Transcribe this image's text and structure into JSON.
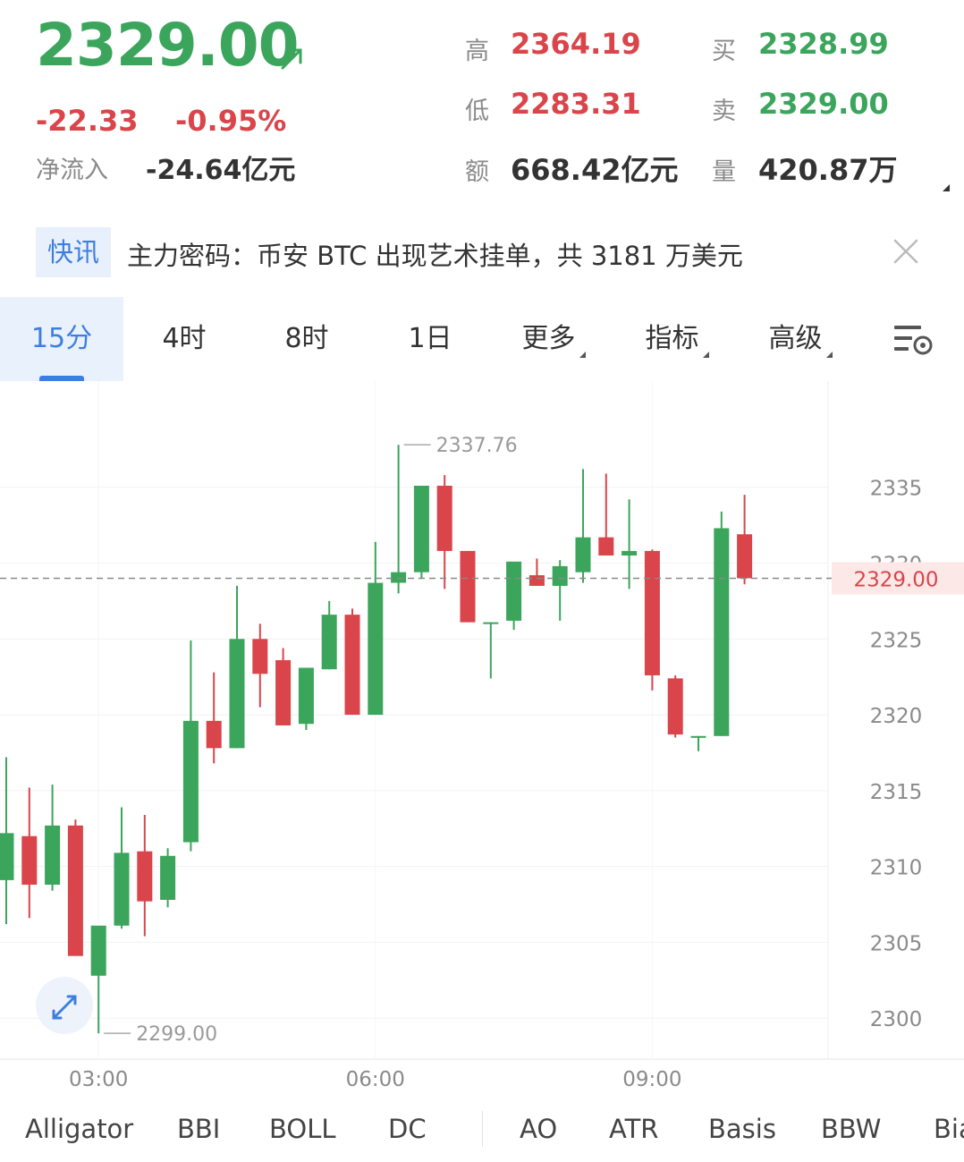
{
  "quote": {
    "price": "2329.00",
    "change": "-22.33",
    "change_pct": "-0.95%",
    "netflow_label": "净流入",
    "netflow_value": "-24.64亿元",
    "high_label": "高",
    "high": "2364.19",
    "low_label": "低",
    "low": "2283.31",
    "amount_label": "额",
    "amount": "668.42亿元",
    "bid_label": "买",
    "bid": "2328.99",
    "ask_label": "卖",
    "ask": "2329.00",
    "volume_label": "量",
    "volume": "420.87万"
  },
  "news": {
    "tag": "快讯",
    "text": "主力密码：币安 BTC 出现艺术挂单，共 3181 万美元"
  },
  "tabs": [
    "15分",
    "4时",
    "8时",
    "1日",
    "更多",
    "指标",
    "高级"
  ],
  "indicators": [
    "Alligator",
    "BBI",
    "BOLL",
    "DC",
    "AO",
    "ATR",
    "Basis",
    "BBW",
    "Bia"
  ],
  "colors": {
    "up": "#3ba55c",
    "down": "#d9454a",
    "accent": "#3d7fe0"
  },
  "chart_data": {
    "type": "candlestick",
    "x_ticks": [
      "03:00",
      "06:00",
      "09:00"
    ],
    "y_ticks": [
      2300,
      2305,
      2310,
      2315,
      2320,
      2325,
      2330,
      2335
    ],
    "ylim": [
      2297.3,
      2342.0
    ],
    "current_price": 2329.0,
    "current_price_label": "2329.00",
    "max_label": "2337.76",
    "min_label": "2299.00",
    "candles": [
      {
        "o": 2309.1,
        "h": 2317.2,
        "l": 2306.2,
        "c": 2312.2
      },
      {
        "o": 2312.0,
        "h": 2315.2,
        "l": 2306.6,
        "c": 2308.8
      },
      {
        "o": 2308.8,
        "h": 2315.4,
        "l": 2308.4,
        "c": 2312.7
      },
      {
        "o": 2312.7,
        "h": 2313.1,
        "l": 2304.7,
        "c": 2304.1
      },
      {
        "o": 2302.8,
        "h": 2305.7,
        "l": 2299.0,
        "c": 2306.1
      },
      {
        "o": 2306.1,
        "h": 2313.9,
        "l": 2305.9,
        "c": 2310.9
      },
      {
        "o": 2311.0,
        "h": 2313.4,
        "l": 2305.4,
        "c": 2307.7
      },
      {
        "o": 2307.8,
        "h": 2311.2,
        "l": 2307.3,
        "c": 2310.7
      },
      {
        "o": 2311.6,
        "h": 2324.9,
        "l": 2311.0,
        "c": 2319.6
      },
      {
        "o": 2319.6,
        "h": 2322.8,
        "l": 2316.8,
        "c": 2317.8
      },
      {
        "o": 2317.8,
        "h": 2328.5,
        "l": 2317.8,
        "c": 2325.0
      },
      {
        "o": 2325.0,
        "h": 2326.0,
        "l": 2320.5,
        "c": 2322.7
      },
      {
        "o": 2323.6,
        "h": 2324.4,
        "l": 2319.6,
        "c": 2319.3
      },
      {
        "o": 2319.4,
        "h": 2323.1,
        "l": 2319.0,
        "c": 2323.1
      },
      {
        "o": 2323.0,
        "h": 2327.5,
        "l": 2323.0,
        "c": 2326.6
      },
      {
        "o": 2326.6,
        "h": 2327.0,
        "l": 2320.0,
        "c": 2320.0
      },
      {
        "o": 2320.0,
        "h": 2331.4,
        "l": 2320.0,
        "c": 2328.7
      },
      {
        "o": 2328.7,
        "h": 2337.8,
        "l": 2328.0,
        "c": 2329.4
      },
      {
        "o": 2329.4,
        "h": 2335.1,
        "l": 2329.0,
        "c": 2335.1
      },
      {
        "o": 2335.1,
        "h": 2335.8,
        "l": 2328.3,
        "c": 2330.8
      },
      {
        "o": 2330.8,
        "h": 2330.8,
        "l": 2326.1,
        "c": 2326.1
      },
      {
        "o": 2326.1,
        "h": 2326.1,
        "l": 2322.4,
        "c": 2326.1
      },
      {
        "o": 2326.2,
        "h": 2330.0,
        "l": 2325.6,
        "c": 2330.1
      },
      {
        "o": 2329.2,
        "h": 2330.3,
        "l": 2328.5,
        "c": 2328.5
      },
      {
        "o": 2328.5,
        "h": 2330.2,
        "l": 2326.2,
        "c": 2329.8
      },
      {
        "o": 2329.4,
        "h": 2336.2,
        "l": 2328.7,
        "c": 2331.7
      },
      {
        "o": 2331.7,
        "h": 2335.9,
        "l": 2331.1,
        "c": 2330.5
      },
      {
        "o": 2330.5,
        "h": 2334.2,
        "l": 2328.3,
        "c": 2330.8
      },
      {
        "o": 2330.8,
        "h": 2330.9,
        "l": 2321.6,
        "c": 2322.6
      },
      {
        "o": 2322.4,
        "h": 2322.6,
        "l": 2318.5,
        "c": 2318.7
      },
      {
        "o": 2318.6,
        "h": 2318.6,
        "l": 2317.6,
        "c": 2318.6
      },
      {
        "o": 2318.6,
        "h": 2333.4,
        "l": 2318.6,
        "c": 2332.3
      },
      {
        "o": 2331.9,
        "h": 2334.5,
        "l": 2328.6,
        "c": 2329.0
      }
    ]
  }
}
